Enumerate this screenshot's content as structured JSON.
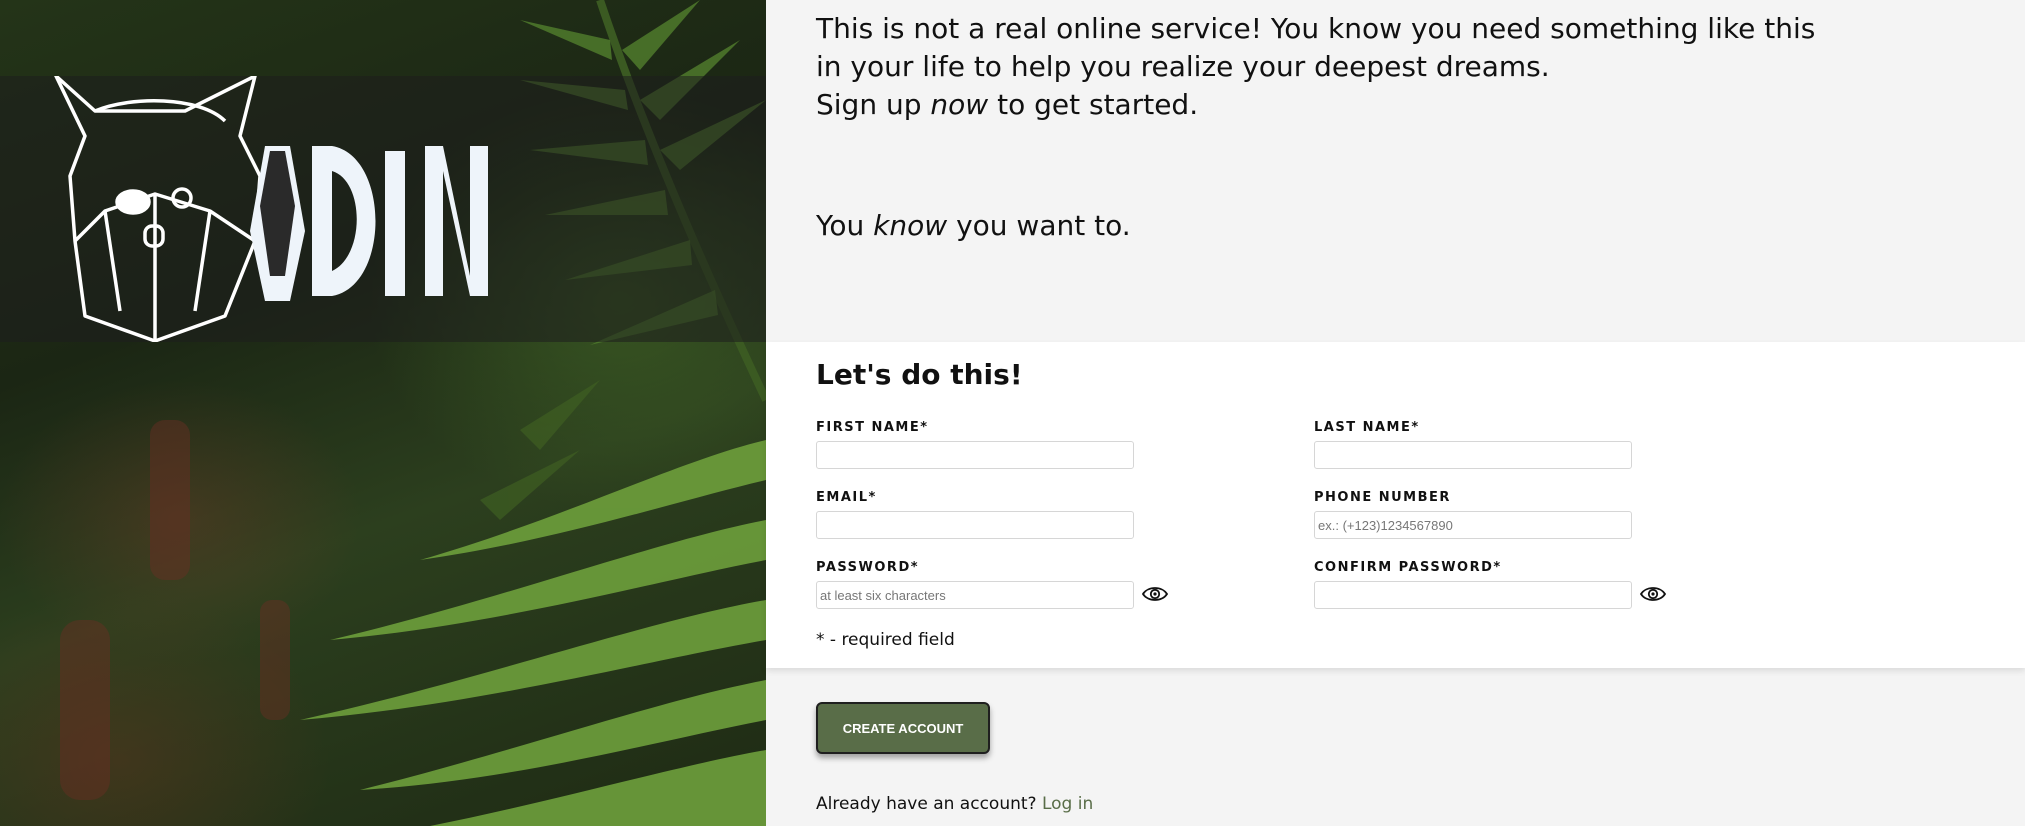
{
  "hero": {
    "logo_text": "ODIN"
  },
  "intro": {
    "line1": "This is not a real online service! You know you need something like this",
    "line2": "in your life to help you realize your deepest dreams.",
    "line3_before": "Sign up ",
    "line3_em": "now",
    "line3_after": " to get started.",
    "know_before": "You ",
    "know_em": "know",
    "know_after": " you want to."
  },
  "form": {
    "title": "Let's do this!",
    "fields": {
      "first_name": {
        "label": "FIRST NAME*",
        "value": "",
        "placeholder": ""
      },
      "last_name": {
        "label": "LAST NAME*",
        "value": "",
        "placeholder": ""
      },
      "email": {
        "label": "EMAIL*",
        "value": "",
        "placeholder": ""
      },
      "phone": {
        "label": "PHONE NUMBER",
        "value": "",
        "placeholder": "ex.: (+123)1234567890"
      },
      "password": {
        "label": "PASSWORD*",
        "value": "",
        "placeholder": "at least six characters"
      },
      "confirm_password": {
        "label": "CONFIRM PASSWORD*",
        "value": "",
        "placeholder": ""
      }
    },
    "required_note": "* - required field"
  },
  "actions": {
    "create_account_label": "CREATE ACCOUNT",
    "login_prompt": "Already have an account? ",
    "login_link": "Log in"
  },
  "icons": {
    "password_toggle": "eye-icon",
    "confirm_toggle": "eye-icon",
    "logo": "viking-head-icon"
  },
  "colors": {
    "accent": "#596d48",
    "panel_bg": "#f4f4f4",
    "card_bg": "#ffffff"
  }
}
